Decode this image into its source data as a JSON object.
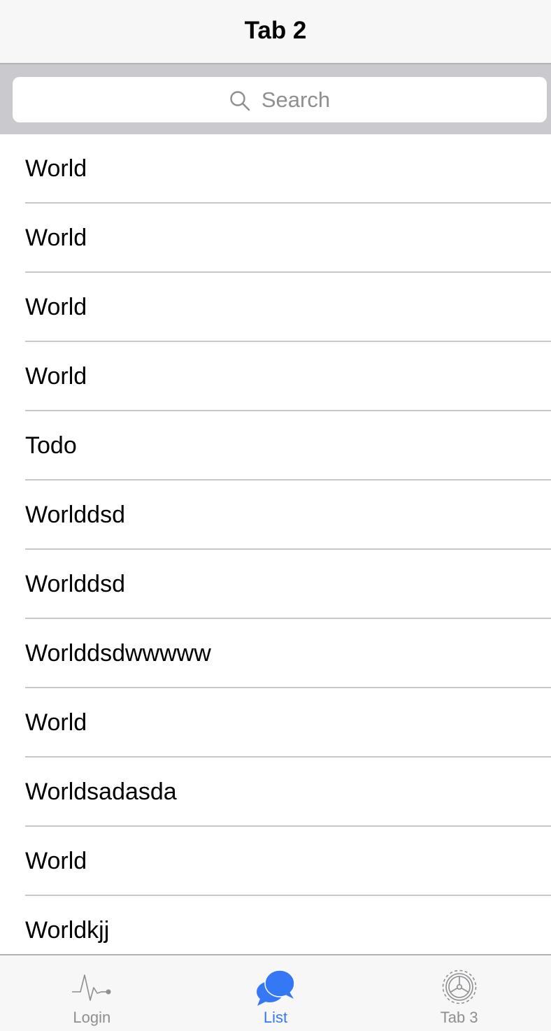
{
  "nav": {
    "title": "Tab 2"
  },
  "search": {
    "placeholder": "Search",
    "icon": "search-icon"
  },
  "list": {
    "items": [
      {
        "label": "World"
      },
      {
        "label": "World"
      },
      {
        "label": "World"
      },
      {
        "label": "World"
      },
      {
        "label": "Todo"
      },
      {
        "label": "Worlddsd"
      },
      {
        "label": "Worlddsd"
      },
      {
        "label": "Worlddsdwwwww"
      },
      {
        "label": "World"
      },
      {
        "label": "Worldsadasda"
      },
      {
        "label": "World"
      },
      {
        "label": "Worldkjj"
      }
    ]
  },
  "tabbar": {
    "tabs": [
      {
        "label": "Login",
        "icon": "pulse-icon",
        "active": false
      },
      {
        "label": "List",
        "icon": "chat-bubbles-icon",
        "active": true
      },
      {
        "label": "Tab 3",
        "icon": "gear-icon",
        "active": false
      }
    ]
  },
  "colors": {
    "accent": "#3478f6",
    "inactive": "#8e8e93",
    "separator": "#c8c7cc",
    "search_bar_bg": "#c9c9ce",
    "bar_bg": "#f7f7f7"
  }
}
